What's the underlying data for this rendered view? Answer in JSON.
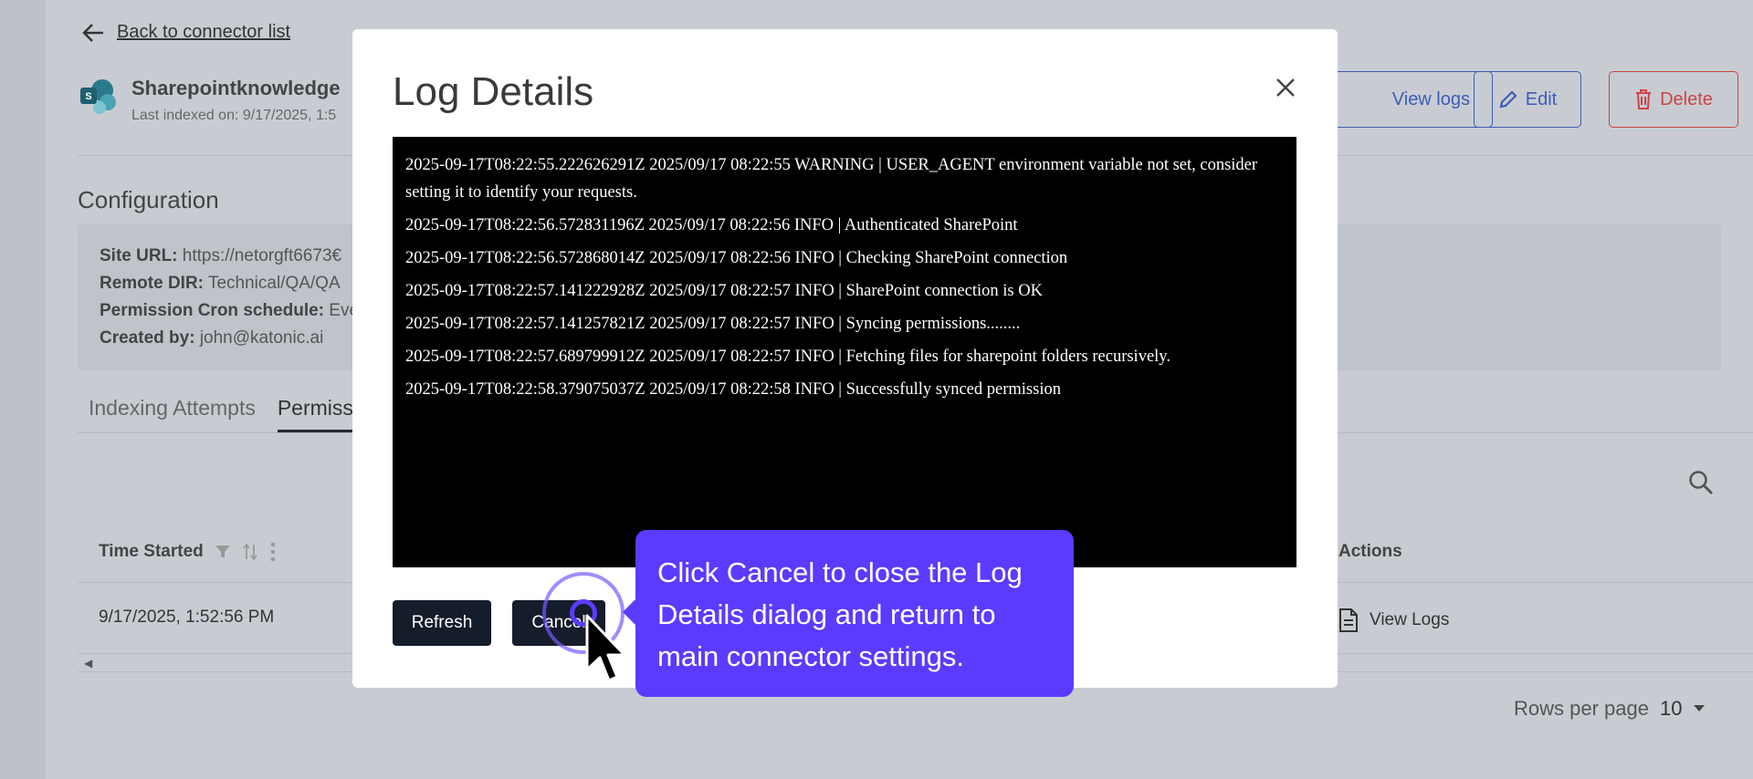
{
  "background": {
    "back_link": "Back to connector list",
    "connector_name": "Sharepointknowledge",
    "last_indexed": "Last indexed on: 9/17/2025, 1:5",
    "header_buttons": {
      "view_logs": "View logs",
      "edit": "Edit",
      "delete": "Delete"
    },
    "config_title": "Configuration",
    "config": [
      {
        "label": "Site URL:",
        "value": "https://netorgft6673€"
      },
      {
        "label": "Remote DIR:",
        "value": "Technical/QA/QA"
      },
      {
        "label": "Permission Cron schedule:",
        "value": "Eve"
      },
      {
        "label": "Created by:",
        "value": "john@katonic.ai"
      }
    ],
    "tabs": [
      "Indexing Attempts",
      "Permiss"
    ],
    "table": {
      "col_time_started": "Time Started",
      "col_actions": "Actions",
      "row_time": "9/17/2025, 1:52:56 PM",
      "row_action": "View Logs"
    },
    "rows_per_page_label": "Rows per page",
    "rows_per_page_value": "10"
  },
  "modal": {
    "title": "Log Details",
    "log_lines": [
      "2025-09-17T08:22:55.222626291Z 2025/09/17 08:22:55 WARNING | USER_AGENT environment variable not set, consider setting it to identify your requests.",
      "2025-09-17T08:22:56.572831196Z 2025/09/17 08:22:56 INFO | Authenticated SharePoint",
      "2025-09-17T08:22:56.572868014Z 2025/09/17 08:22:56 INFO | Checking SharePoint connection",
      "2025-09-17T08:22:57.141222928Z 2025/09/17 08:22:57 INFO | SharePoint connection is OK",
      "2025-09-17T08:22:57.141257821Z 2025/09/17 08:22:57 INFO | Syncing permissions........",
      "2025-09-17T08:22:57.689799912Z 2025/09/17 08:22:57 INFO | Fetching files for sharepoint folders recursively.",
      "2025-09-17T08:22:58.379075037Z 2025/09/17 08:22:58 INFO | Successfully synced permission"
    ],
    "refresh_label": "Refresh",
    "cancel_label": "Cancel"
  },
  "tooltip": {
    "text": "Click Cancel to close the Log Details dialog and return to main connector settings."
  },
  "colors": {
    "accent": "#5b3bff",
    "dark_button": "#151c2a",
    "brand_blue": "#3f5bb8",
    "danger": "#cc4444"
  }
}
